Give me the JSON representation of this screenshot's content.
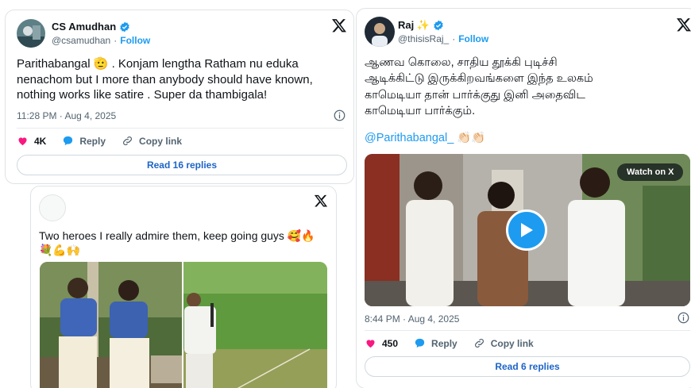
{
  "tweet1": {
    "name": "CS Amudhan",
    "handle": "@csamudhan",
    "follow": "Follow",
    "text_line1": "Parithabangal 🫡 . Konjam lengtha Ratham nu eduka",
    "text_line2": "nenachom but I  more than anybody should have known,",
    "text_line3": "nothing works like satire . Super da thambigala!",
    "time": "11:28 PM · Aug 4, 2025",
    "likes": "4K",
    "reply": "Reply",
    "copy_link": "Copy link",
    "read_replies": "Read 16 replies"
  },
  "tweet2": {
    "text_line1": "Two heroes I really admire them, keep going guys 🥰🔥",
    "text_line2": "💐💪🙌"
  },
  "tweet3": {
    "name": "Raj ✨",
    "handle": "@thisisRaj_",
    "follow": "Follow",
    "text_line1": "ஆணவ கொலை, சாதிய தூக்கி புடிச்சி",
    "text_line2": "ஆடிக்கிட்டு இருக்கிறவங்களை இந்த உலகம்",
    "text_line3": "காமெடியா தான் பார்க்குது இனி அதைவிட",
    "text_line4": "காமெடியா பார்க்கும்.",
    "mention": "@Parithabangal_ 👏🏻👏🏻",
    "watch_label": "Watch on X",
    "time": "8:44 PM · Aug 4, 2025",
    "likes": "450",
    "reply": "Reply",
    "copy_link": "Copy link",
    "read_replies": "Read 6 replies"
  },
  "colors": {
    "accent": "#1d9bf0",
    "heart": "#f91880",
    "link_text": "#1d64c8",
    "muted": "#536471"
  },
  "icons": [
    "verified-badge-icon",
    "x-logo-icon",
    "info-icon",
    "heart-icon",
    "reply-bubble-icon",
    "link-icon",
    "play-icon"
  ]
}
